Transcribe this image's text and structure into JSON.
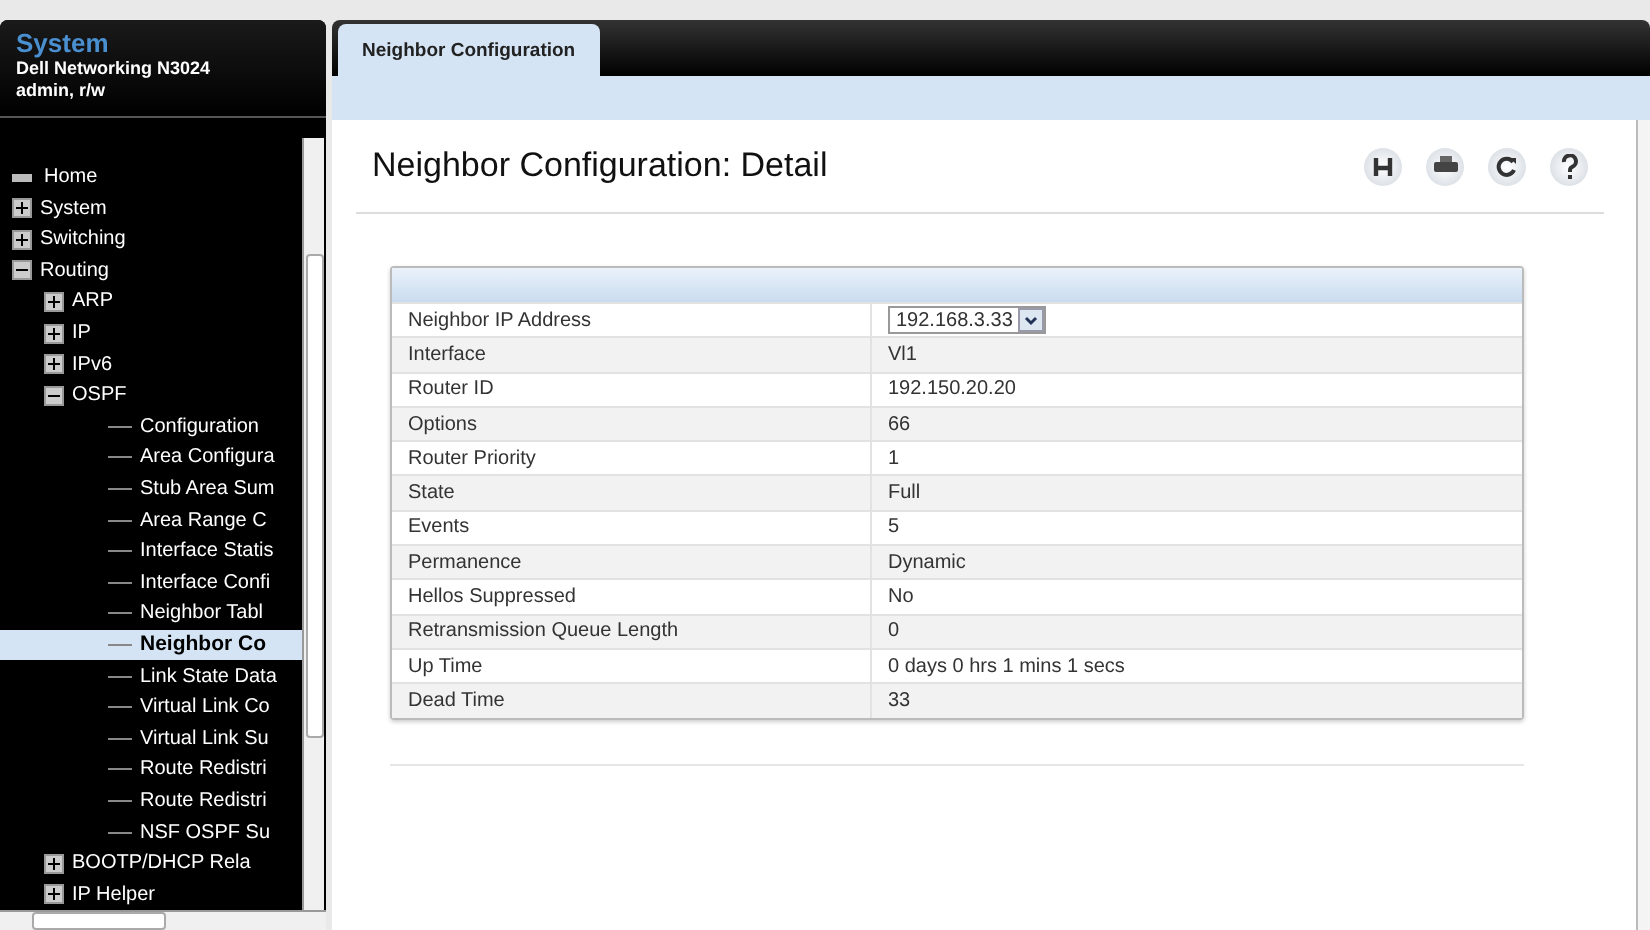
{
  "sidebar": {
    "title": "System",
    "device": "Dell Networking N3024",
    "user": "admin, r/w",
    "tree": [
      {
        "label": "Home",
        "kind": "home",
        "selected": false
      },
      {
        "label": "System",
        "kind": "folder",
        "expanded": false,
        "selected": false
      },
      {
        "label": "Switching",
        "kind": "folder",
        "expanded": false,
        "selected": false
      },
      {
        "label": "Routing",
        "kind": "folder",
        "expanded": true,
        "selected": false,
        "children": [
          {
            "label": "ARP",
            "kind": "folder",
            "expanded": false,
            "selected": false
          },
          {
            "label": "IP",
            "kind": "folder",
            "expanded": false,
            "selected": false
          },
          {
            "label": "IPv6",
            "kind": "folder",
            "expanded": false,
            "selected": false
          },
          {
            "label": "OSPF",
            "kind": "folder",
            "expanded": true,
            "selected": false,
            "children": [
              {
                "label": "Configuration",
                "kind": "page",
                "selected": false
              },
              {
                "label": "Area Configura",
                "kind": "page",
                "selected": false
              },
              {
                "label": "Stub Area Sum",
                "kind": "page",
                "selected": false
              },
              {
                "label": "Area Range C",
                "kind": "page",
                "selected": false
              },
              {
                "label": "Interface Statis",
                "kind": "page",
                "selected": false
              },
              {
                "label": "Interface Confi",
                "kind": "page",
                "selected": false
              },
              {
                "label": "Neighbor Tabl",
                "kind": "page",
                "selected": false
              },
              {
                "label": "Neighbor Co",
                "kind": "page",
                "selected": true
              },
              {
                "label": "Link State Data",
                "kind": "page",
                "selected": false
              },
              {
                "label": "Virtual Link Co",
                "kind": "page",
                "selected": false
              },
              {
                "label": "Virtual Link Su",
                "kind": "page",
                "selected": false
              },
              {
                "label": "Route Redistri",
                "kind": "page",
                "selected": false
              },
              {
                "label": "Route Redistri",
                "kind": "page",
                "selected": false
              },
              {
                "label": "NSF OSPF Su",
                "kind": "page",
                "selected": false
              }
            ]
          },
          {
            "label": "BOOTP/DHCP Rela",
            "kind": "folder",
            "expanded": false,
            "selected": false
          },
          {
            "label": "IP Helper",
            "kind": "folder",
            "expanded": false,
            "selected": false
          }
        ]
      }
    ]
  },
  "tabs": [
    {
      "label": "Neighbor Configuration",
      "selected": true
    }
  ],
  "page": {
    "title": "Neighbor Configuration: Detail"
  },
  "table": {
    "rows": [
      {
        "label": "Neighbor IP Address",
        "value": "192.168.3.33",
        "kind": "select"
      },
      {
        "label": "Interface",
        "value": "Vl1",
        "kind": "text"
      },
      {
        "label": "Router ID",
        "value": "192.150.20.20",
        "kind": "text"
      },
      {
        "label": "Options",
        "value": "66",
        "kind": "text"
      },
      {
        "label": "Router Priority",
        "value": "1",
        "kind": "text"
      },
      {
        "label": "State",
        "value": "Full",
        "kind": "text"
      },
      {
        "label": "Events",
        "value": "5",
        "kind": "text"
      },
      {
        "label": "Permanence",
        "value": "Dynamic",
        "kind": "text"
      },
      {
        "label": "Hellos Suppressed",
        "value": "No",
        "kind": "text"
      },
      {
        "label": "Retransmission Queue Length",
        "value": "0",
        "kind": "text"
      },
      {
        "label": "Up Time",
        "value": "0 days 0 hrs 1 mins 1 secs",
        "kind": "text"
      },
      {
        "label": "Dead Time",
        "value": "33",
        "kind": "text"
      }
    ]
  }
}
